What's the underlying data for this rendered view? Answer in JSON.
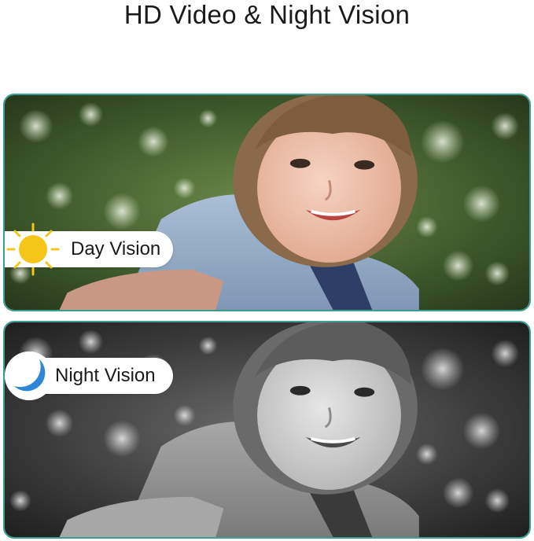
{
  "title": "HD Video & Night Vision",
  "day": {
    "label": "Day Vision",
    "icon": "sun-icon",
    "sun_color": "#f5c518"
  },
  "night": {
    "label": "Night Vision",
    "icon": "moon-icon",
    "moon_color": "#2f86d6"
  },
  "colors": {
    "panel_border": "#3a9e93"
  }
}
